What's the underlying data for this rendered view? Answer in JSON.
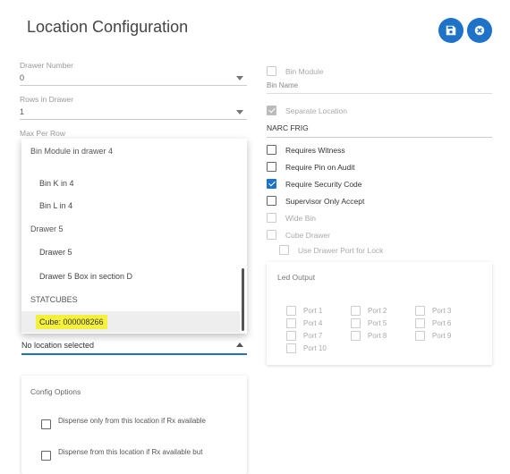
{
  "header": {
    "title": "Location Configuration",
    "save_icon": "save-icon",
    "close_icon": "close-icon",
    "accent": "#1e73c8"
  },
  "left": {
    "drawer_number": {
      "label": "Drawer Number",
      "value": "0"
    },
    "rows_in_drawer": {
      "label": "Rows in Drawer",
      "value": "1"
    },
    "max_per_row": {
      "label": "Max Per Row"
    },
    "dropdown": {
      "items": [
        {
          "kind": "group",
          "label": "Bin Module in drawer 4"
        },
        {
          "kind": "option",
          "label": "Bin K in 4"
        },
        {
          "kind": "option",
          "label": "Bin L in 4"
        },
        {
          "kind": "group",
          "label": "Drawer 5"
        },
        {
          "kind": "option",
          "label": "Drawer 5"
        },
        {
          "kind": "option",
          "label": "Drawer 5 Box in section D"
        },
        {
          "kind": "group",
          "label": "STATCUBES"
        },
        {
          "kind": "option",
          "label": "Cube: 000008266",
          "highlight": "#f5f03a"
        }
      ]
    },
    "location_select": {
      "value": "No location selected"
    },
    "config": {
      "title": "Config Options",
      "options": [
        "Dispense only from this location if Rx available",
        "Dispense from this location if Rx available but"
      ]
    }
  },
  "right": {
    "bin_module": {
      "label": "Bin Module",
      "checked": false,
      "disabled": true
    },
    "bin_name": {
      "label": "Bin Name"
    },
    "separate_location": {
      "label": "Separate Location",
      "checked": true,
      "disabled": true
    },
    "location_value": "NARC FRIG",
    "checks": [
      {
        "label": "Requires Witness",
        "checked": false,
        "disabled": false
      },
      {
        "label": "Require Pin on Audit",
        "checked": false,
        "disabled": false
      },
      {
        "label": "Require Security Code",
        "checked": true,
        "disabled": false
      },
      {
        "label": "Supervisor Only Accept",
        "checked": false,
        "disabled": false
      },
      {
        "label": "Wide Bin",
        "checked": false,
        "disabled": true
      },
      {
        "label": "Cube Drawer",
        "checked": false,
        "disabled": true
      }
    ],
    "use_drawer_port": {
      "label": "Use Drawer Port for Lock",
      "checked": false,
      "disabled": true
    },
    "led_output": {
      "title": "Led Output",
      "ports": [
        "Port 1",
        "Port 2",
        "Port 3",
        "Port 4",
        "Port 5",
        "Port 6",
        "Port 7",
        "Port 8",
        "Port 9",
        "Port 10"
      ]
    }
  }
}
